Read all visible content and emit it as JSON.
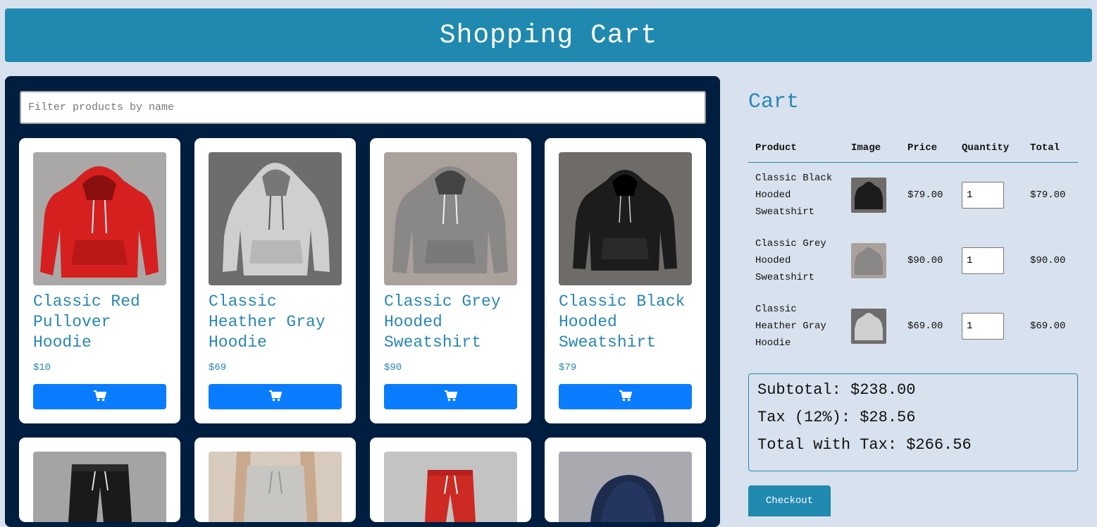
{
  "header": {
    "title": "Shopping Cart"
  },
  "filter": {
    "placeholder": "Filter products by name"
  },
  "products": [
    {
      "name": "Classic Red Pullover Hoodie",
      "price": "$10",
      "icon": "cart-icon"
    },
    {
      "name": "Classic Heather Gray Hoodie",
      "price": "$69",
      "icon": "cart-icon"
    },
    {
      "name": "Classic Grey Hooded Sweatshirt",
      "price": "$90",
      "icon": "cart-icon"
    },
    {
      "name": "Classic Black Hooded Sweatshirt",
      "price": "$79",
      "icon": "cart-icon"
    }
  ],
  "cart": {
    "title": "Cart",
    "columns": [
      "Product",
      "Image",
      "Price",
      "Quantity",
      "Total"
    ],
    "rows": [
      {
        "product": "Classic Black Hooded Sweatshirt",
        "price": "$79.00",
        "quantity": "1",
        "total": "$79.00"
      },
      {
        "product": "Classic Grey Hooded Sweatshirt",
        "price": "$90.00",
        "quantity": "1",
        "total": "$90.00"
      },
      {
        "product": "Classic Heather Gray Hoodie",
        "price": "$69.00",
        "quantity": "1",
        "total": "$69.00"
      }
    ],
    "subtotal": "Subtotal: $238.00",
    "tax": "Tax (12%): $28.56",
    "total_with_tax": "Total with Tax: $266.56",
    "checkout_label": "Checkout"
  },
  "colors": {
    "header_bg": "#2089b0",
    "panel_bg": "#001e3f",
    "accent": "#2a87b4",
    "button": "#0a7cff",
    "page_bg": "#d8e2ee"
  }
}
